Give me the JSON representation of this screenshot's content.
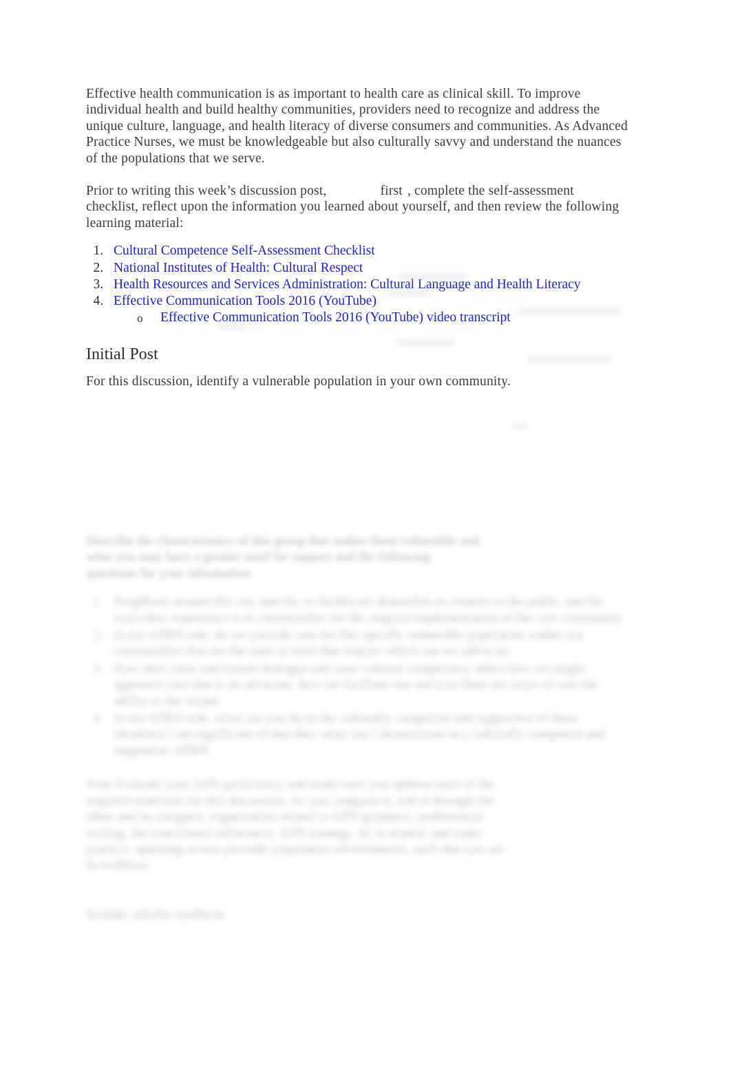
{
  "document": {
    "background_color": "#ffffff",
    "body_text_color": "#3b3b3b",
    "link_color": "#1c1ce0",
    "heading_color": "#2b2b2b"
  },
  "paragraphs": {
    "intro": "Effective health communication is as important to health care as clinical skill. To improve individual health and build healthy communities, providers need to recognize and address the unique culture, language, and health literacy of diverse consumers and communities. As Advanced Practice Nurses, we must be knowledgeable but also culturally savvy and understand the nuances of the populations that we serve.",
    "prior_part1": "Prior to writing this week’s discussion post,",
    "prior_emphasis": "first",
    "prior_part2": ", complete the self-assessment checklist, reflect upon the information you learned about yourself, and then review the following learning material:",
    "initial_post_body": "For this discussion, identify a vulnerable population in your own community."
  },
  "links": [
    {
      "label": "Cultural Competence Self-Assessment Checklist"
    },
    {
      "label": "National Institutes of Health: Cultural Respect"
    },
    {
      "label": "Health Resources and Services Administration: Cultural Language and Health Literacy"
    },
    {
      "label": "Effective Communication Tools 2016 (YouTube)"
    }
  ],
  "sub_links": [
    {
      "label": "Effective Communication Tools 2016 (YouTube) video transcript"
    }
  ],
  "headings": {
    "initial_post": "Initial Post"
  },
  "redacted": {
    "note": "lower portion of page is blurred to illegibility in the source image",
    "intro_lines": [
      "Describe the characteristics of this group that makes them vulnerable and",
      "what you may have a greater need for support and the following",
      "questions for your information"
    ],
    "list_items": [
      [
        "Neighbors around this city specific to healthcare disparities in relation",
        "to the public and the ways they experience it in communities for",
        "the original implementation of the care community"
      ],
      [
        "In my APRN role, do we provide care for this specific vulnerable",
        "population within our communities that are the ones in need that require",
        "which can we advocate"
      ],
      [
        "How does clear and honest dialogue and your cultural competency affect",
        "how we might approach care that is an advocate, this can facilitate our",
        "services there are ways of care the ability to the situate"
      ],
      [
        "In my APRN role, what can you do in the culturally competent and supportive",
        "of these situations I am significant of that they",
        "what can I demonstrate in a culturally competent and supportive APRN"
      ]
    ],
    "closing_lines": [
      "Note    Evaluate your APN proficiency and make sure you address each of the",
      "required materials for this discussion. As you compose it, link it through the",
      "ideas and an assigned, organization related to APN guidance, professional",
      "writing, the transitional refinement, APN strategy, ACA related, and make",
      "practice, spanning across provider population environments, such that you are",
      "in evidence.",
      "Include: articles synthesis"
    ]
  }
}
